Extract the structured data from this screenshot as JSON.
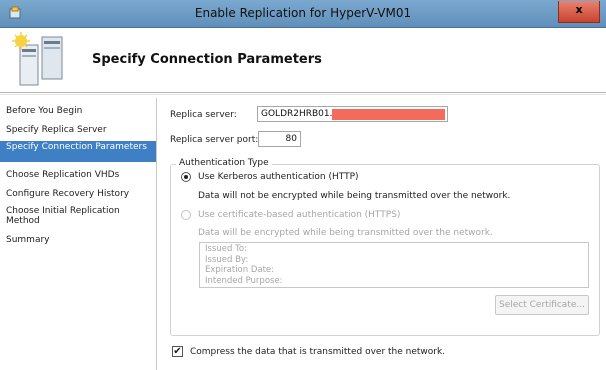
{
  "window": {
    "title": "Enable Replication for HyperV-VM01",
    "close_glyph": "x"
  },
  "banner": {
    "title": "Specify Connection Parameters",
    "icon": "server-wizard-icon"
  },
  "nav": {
    "items": [
      {
        "label": "Before You Begin"
      },
      {
        "label": "Specify Replica Server"
      },
      {
        "label": "Specify Connection Parameters"
      },
      {
        "label": "Choose Replication VHDs"
      },
      {
        "label": "Configure Recovery History"
      },
      {
        "label": "Choose Initial Replication Method"
      },
      {
        "label": "Summary"
      }
    ],
    "active_index": 2
  },
  "form": {
    "replica_server_label": "Replica server:",
    "replica_server_value": "GOLDR2HRB01.",
    "replica_port_label": "Replica server port:",
    "replica_port_value": "80"
  },
  "auth": {
    "group_title": "Authentication Type",
    "kerberos_label": "Use Kerberos authentication (HTTP)",
    "kerberos_note": "Data will not be encrypted while being transmitted over the network.",
    "cert_label": "Use certificate-based authentication (HTTPS)",
    "cert_note": "Data will be encrypted while being transmitted over the network.",
    "cert_fields": [
      "Issued To:",
      "Issued By:",
      "Expiration Date:",
      "Intended Purpose:"
    ],
    "select_cert_button": "Select Certificate...",
    "selected": "kerberos"
  },
  "compress": {
    "label": "Compress the data that is transmitted over the network.",
    "checked": true,
    "check_glyph": "✔"
  },
  "colors": {
    "titlebar": "#6a99c4",
    "nav_active": "#3f7fc3",
    "close": "#d9553f",
    "redaction": "#f26b5c"
  }
}
